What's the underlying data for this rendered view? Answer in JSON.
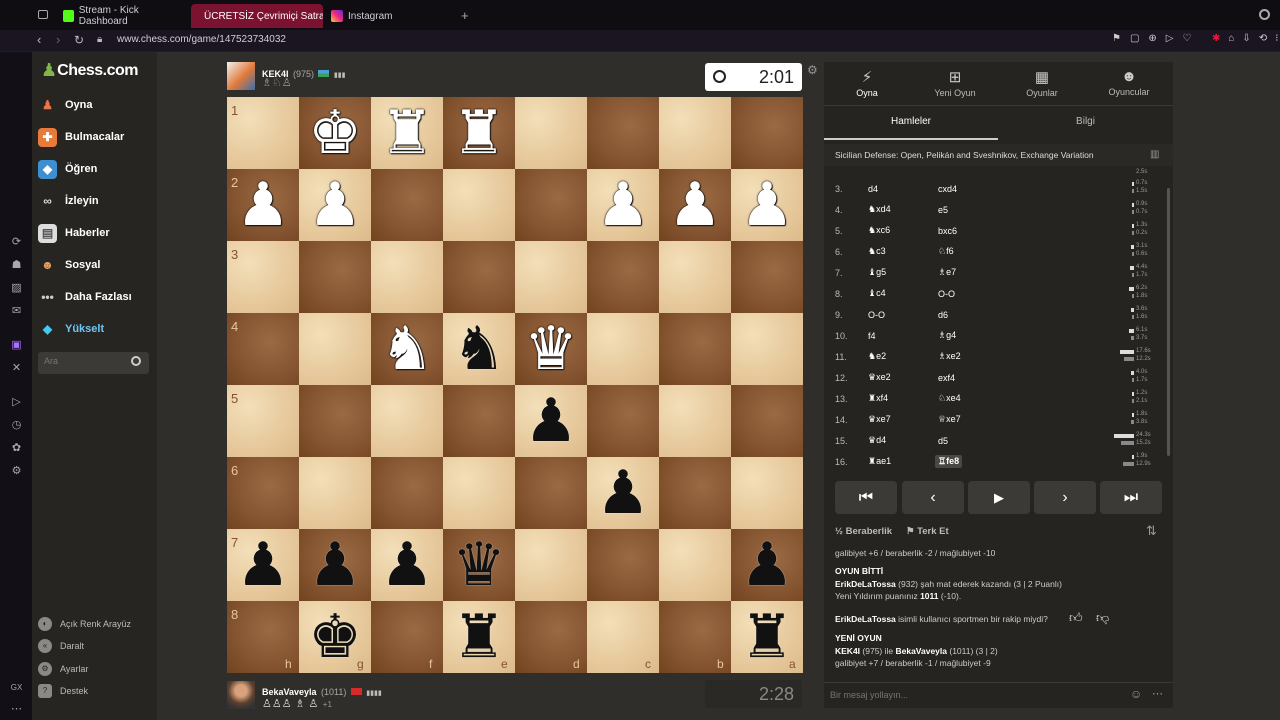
{
  "browser": {
    "tabs": [
      {
        "label": "Stream - Kick Dashboard",
        "active": false
      },
      {
        "label": "ÜCRETSİZ Çevrimiçi Satra",
        "active": true
      },
      {
        "label": "Instagram",
        "active": false
      }
    ],
    "url": "www.chess.com/game/147523734032"
  },
  "nav": {
    "logo": "Chess.com",
    "items": [
      "Oyna",
      "Bulmacalar",
      "Öğren",
      "İzleyin",
      "Haberler",
      "Sosyal",
      "Daha Fazlası",
      "Yükselt"
    ],
    "search_placeholder": "Ara",
    "bottom": [
      "Açık Renk Arayüz",
      "Daralt",
      "Ayarlar",
      "Destek"
    ]
  },
  "top_player": {
    "name": "KEK4I",
    "rating": "(975)",
    "clock": "2:01",
    "captured": "♗♘♙"
  },
  "bottom_player": {
    "name": "BekaVaveyla",
    "rating": "(1011)",
    "clock": "2:28",
    "captured": "♙♙♙ ♗ ♙",
    "plus": "+1"
  },
  "board": {
    "ranks": [
      "1",
      "2",
      "3",
      "4",
      "5",
      "6",
      "7",
      "8"
    ],
    "files": [
      "h",
      "g",
      "f",
      "e",
      "d",
      "c",
      "b",
      "a"
    ],
    "pieces": [
      {
        "sq": "g1",
        "c": "w",
        "p": "♚"
      },
      {
        "sq": "f1",
        "c": "w",
        "p": "♜"
      },
      {
        "sq": "e1",
        "c": "w",
        "p": "♜"
      },
      {
        "sq": "h2",
        "c": "w",
        "p": "♟"
      },
      {
        "sq": "g2",
        "c": "w",
        "p": "♟"
      },
      {
        "sq": "c2",
        "c": "w",
        "p": "♟"
      },
      {
        "sq": "b2",
        "c": "w",
        "p": "♟"
      },
      {
        "sq": "a2",
        "c": "w",
        "p": "♟"
      },
      {
        "sq": "f4",
        "c": "w",
        "p": "♞"
      },
      {
        "sq": "e4",
        "c": "b",
        "p": "♞"
      },
      {
        "sq": "d4",
        "c": "w",
        "p": "♛"
      },
      {
        "sq": "d5",
        "c": "b",
        "p": "♟"
      },
      {
        "sq": "c6",
        "c": "b",
        "p": "♟"
      },
      {
        "sq": "h7",
        "c": "b",
        "p": "♟"
      },
      {
        "sq": "g7",
        "c": "b",
        "p": "♟"
      },
      {
        "sq": "f7",
        "c": "b",
        "p": "♟"
      },
      {
        "sq": "e7",
        "c": "b",
        "p": "♛"
      },
      {
        "sq": "a7",
        "c": "b",
        "p": "♟"
      },
      {
        "sq": "g8",
        "c": "b",
        "p": "♚"
      },
      {
        "sq": "e8",
        "c": "b",
        "p": "♜"
      },
      {
        "sq": "a8",
        "c": "b",
        "p": "♜"
      }
    ]
  },
  "panel": {
    "tabs": [
      "Oyna",
      "Yeni Oyun",
      "Oyunlar",
      "Oyuncular"
    ],
    "subtabs": [
      "Hamleler",
      "Bilgi"
    ],
    "opening": "Sicilian Defense: Open, Pelikán and Sveshnikov, Exchange Variation",
    "moves": [
      {
        "no": "3.",
        "w": "d4",
        "b": "cxd4",
        "t": [
          "0.7s",
          "1.5s"
        ],
        "f": [
          0.03,
          0.06
        ]
      },
      {
        "no": "4.",
        "w": "♞xd4",
        "b": "e5",
        "t": [
          "0.9s",
          "0.7s"
        ],
        "f": [
          0.04,
          0.03
        ]
      },
      {
        "no": "5.",
        "w": "♞xc6",
        "b": "bxc6",
        "t": [
          "1.3s",
          "0.2s"
        ],
        "f": [
          0.05,
          0.01
        ]
      },
      {
        "no": "6.",
        "w": "♞c3",
        "b": "♘f6",
        "t": [
          "3.1s",
          "0.6s"
        ],
        "f": [
          0.13,
          0.02
        ]
      },
      {
        "no": "7.",
        "w": "♝g5",
        "b": "♗e7",
        "t": [
          "4.4s",
          "1.7s"
        ],
        "f": [
          0.18,
          0.07
        ]
      },
      {
        "no": "8.",
        "w": "♝c4",
        "b": "O-O",
        "t": [
          "6.2s",
          "1.8s"
        ],
        "f": [
          0.25,
          0.07
        ]
      },
      {
        "no": "9.",
        "w": "O-O",
        "b": "d6",
        "t": [
          "3.6s",
          "1.6s"
        ],
        "f": [
          0.15,
          0.07
        ]
      },
      {
        "no": "10.",
        "w": "f4",
        "b": "♗g4",
        "t": [
          "6.1s",
          "3.7s"
        ],
        "f": [
          0.25,
          0.15
        ]
      },
      {
        "no": "11.",
        "w": "♞e2",
        "b": "♗xe2",
        "t": [
          "17.6s",
          "12.2s"
        ],
        "f": [
          0.72,
          0.5
        ]
      },
      {
        "no": "12.",
        "w": "♛xe2",
        "b": "exf4",
        "t": [
          "4.0s",
          "1.7s"
        ],
        "f": [
          0.16,
          0.07
        ]
      },
      {
        "no": "13.",
        "w": "♜xf4",
        "b": "♘xe4",
        "t": [
          "1.2s",
          "2.1s"
        ],
        "f": [
          0.05,
          0.09
        ]
      },
      {
        "no": "14.",
        "w": "♛xe7",
        "b": "♕xe7",
        "t": [
          "1.8s",
          "3.8s"
        ],
        "f": [
          0.07,
          0.16
        ]
      },
      {
        "no": "15.",
        "w": "♛d4",
        "b": "d5",
        "t": [
          "24.3s",
          "15.2s"
        ],
        "f": [
          1.0,
          0.63
        ]
      },
      {
        "no": "16.",
        "w": "♜ae1",
        "b": "♖fe8",
        "t": [
          "1.9s",
          "12.9s"
        ],
        "f": [
          0.08,
          0.53
        ]
      }
    ],
    "top_time": "2.5s",
    "draw_label": "Beraberlik",
    "resign_label": "Terk Et",
    "chat": {
      "line1": "galibiyet +6 / beraberlik -2 / mağlubiyet -10",
      "over_title": "OYUN BİTTİ",
      "over_l1_name": "ErikDeLaTossa",
      "over_l1_rest": " (932) şah mat ederek kazandı (3 | 2 Puanlı)",
      "over_l2_pre": "Yeni Yıldırım puanınız ",
      "over_l2_val": "1011",
      "over_l2_post": " (-10).",
      "sports_name": "ErikDeLaTossa",
      "sports_rest": " isimli kullanıcı sportmen bir rakip miydi?",
      "new_title": "YENİ OYUN",
      "new_p1": "KEK4I",
      "new_mid1": " (975) ile ",
      "new_p2": "BekaVaveyla",
      "new_mid2": " (1011) (3 | 2)",
      "new_line2": "galibiyet +7 / beraberlik -1 / mağlubiyet -9"
    },
    "message_placeholder": "Bir mesaj yollayın..."
  }
}
